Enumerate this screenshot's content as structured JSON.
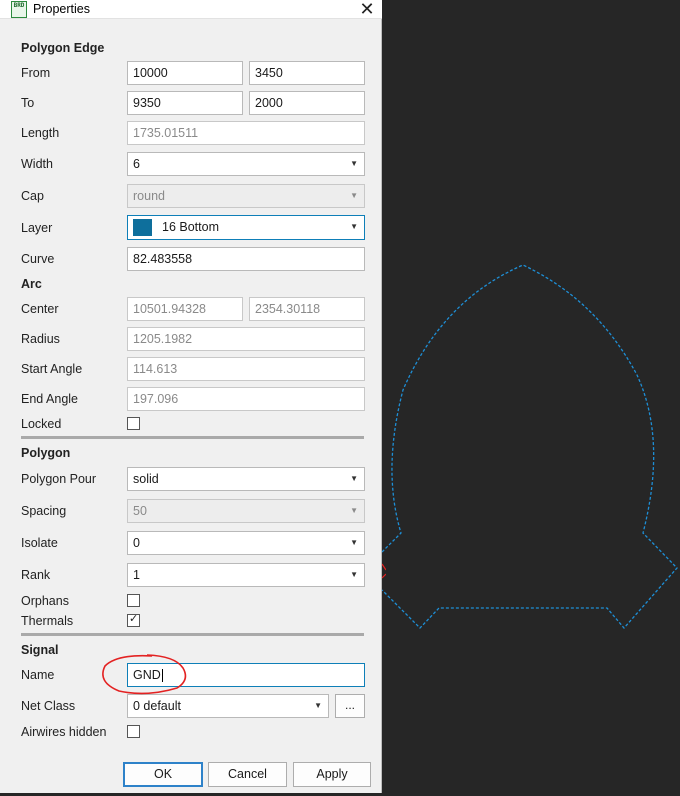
{
  "window": {
    "title": "Properties",
    "app_icon_text": "BRD"
  },
  "sections": {
    "polygon_edge": "Polygon Edge",
    "arc": "Arc",
    "polygon": "Polygon",
    "signal": "Signal"
  },
  "edge": {
    "from_label": "From",
    "from_x": "10000",
    "from_y": "3450",
    "to_label": "To",
    "to_x": "9350",
    "to_y": "2000",
    "length_label": "Length",
    "length": "1735.01511",
    "width_label": "Width",
    "width": "6",
    "cap_label": "Cap",
    "cap": "round",
    "layer_label": "Layer",
    "layer": "16 Bottom",
    "layer_color": "#0e6f9c",
    "curve_label": "Curve",
    "curve": "82.483558"
  },
  "arc": {
    "center_label": "Center",
    "center_x": "10501.94328",
    "center_y": "2354.30118",
    "radius_label": "Radius",
    "radius": "1205.1982",
    "start_label": "Start Angle",
    "start": "114.613",
    "end_label": "End Angle",
    "end": "197.096",
    "locked_label": "Locked",
    "locked": false
  },
  "polygon": {
    "pour_label": "Polygon Pour",
    "pour": "solid",
    "spacing_label": "Spacing",
    "spacing": "50",
    "isolate_label": "Isolate",
    "isolate": "0",
    "rank_label": "Rank",
    "rank": "1",
    "orphans_label": "Orphans",
    "orphans": false,
    "thermals_label": "Thermals",
    "thermals": true
  },
  "signal": {
    "name_label": "Name",
    "name": "GND",
    "netclass_label": "Net Class",
    "netclass": "0 default",
    "netclass_more": "...",
    "airwires_label": "Airwires hidden",
    "airwires_hidden": false
  },
  "buttons": {
    "ok": "OK",
    "cancel": "Cancel",
    "apply": "Apply"
  },
  "colors": {
    "outline": "#1e8fd6",
    "annotation": "#e32222",
    "focus": "#0e7fb8"
  }
}
